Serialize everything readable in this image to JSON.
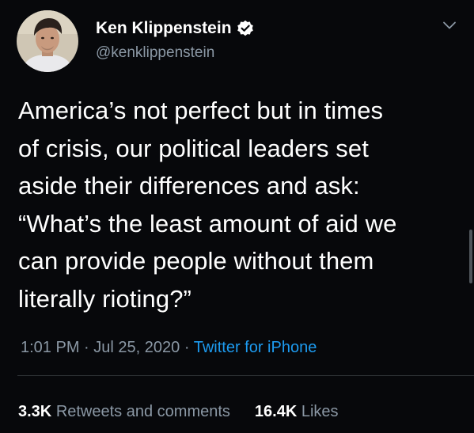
{
  "author": {
    "name": "Ken Klippenstein",
    "handle": "@kenklippenstein",
    "verified": true,
    "avatar_icon": "user-avatar"
  },
  "tweet": {
    "text": "America’s not perfect but in times\nof crisis, our political leaders set\naside their differences and ask:\n“What’s the least amount of aid we\ncan provide people without them\nliterally rioting?”",
    "time": "1:01 PM",
    "date": "Jul 25, 2020",
    "separator": "·",
    "source": "Twitter for iPhone"
  },
  "stats": {
    "retweets_count": "3.3K",
    "retweets_label": "Retweets and comments",
    "likes_count": "16.4K",
    "likes_label": "Likes"
  },
  "icons": {
    "verified": "verified-badge-icon",
    "more": "chevron-down-icon"
  },
  "colors": {
    "background": "#07080b",
    "text": "#ffffff",
    "secondary": "#8b98a5",
    "link": "#1d9bf0",
    "divider": "#2f3336"
  }
}
